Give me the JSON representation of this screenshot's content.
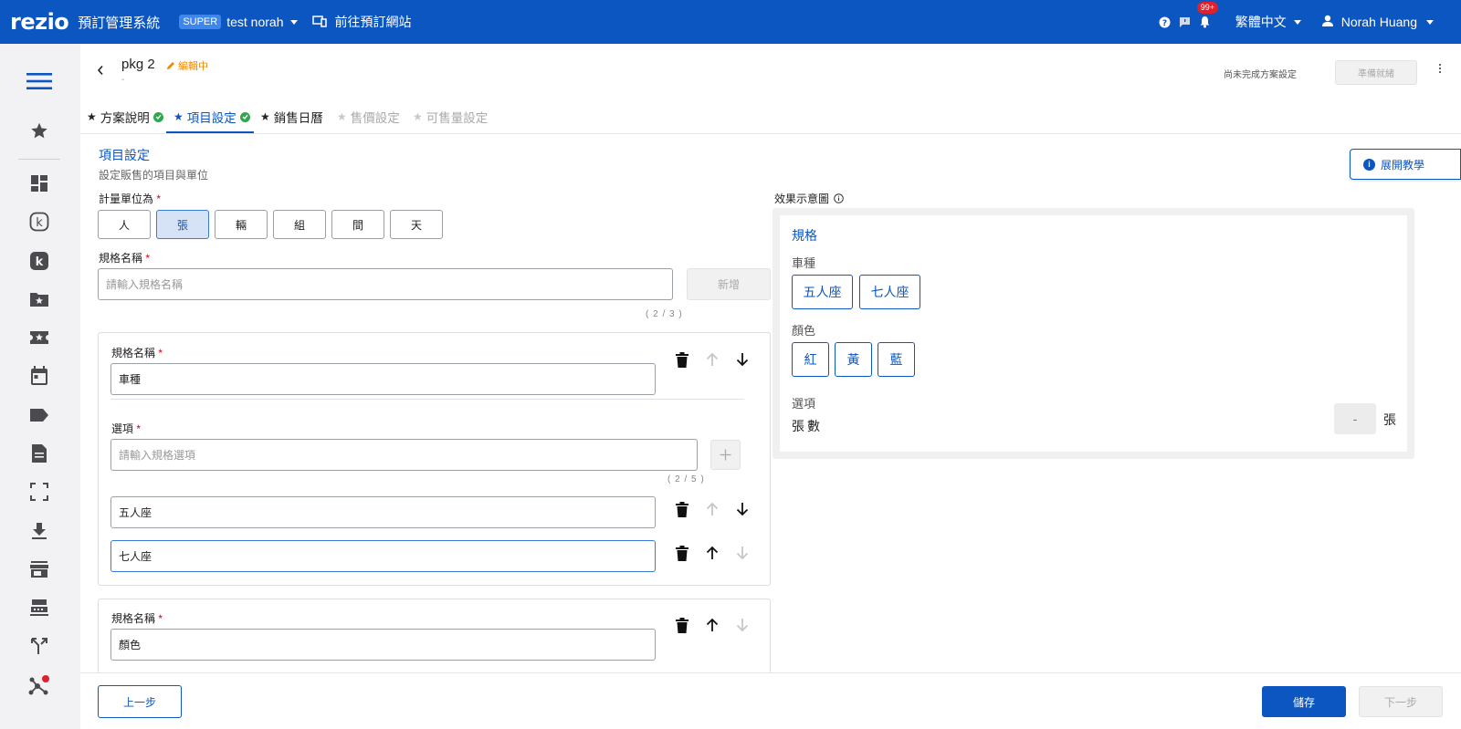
{
  "header": {
    "logo": "rezio",
    "system_title": "預訂管理系統",
    "badge": "SUPER",
    "account": "test norah",
    "goto_link": "前往預訂網站",
    "notif_count": "99+",
    "language": "繁體中文",
    "user": "Norah Huang"
  },
  "sidebar": {
    "icons": [
      "menu-icon",
      "star-icon",
      "dashboard-icon",
      "k-outline-icon",
      "k-filled-icon",
      "folder-star-icon",
      "ticket-star-icon",
      "calendar-icon",
      "tag-icon",
      "document-icon",
      "fullscreen-icon",
      "download-icon",
      "store-icon",
      "cash-register-icon",
      "merge-icon",
      "hub-icon"
    ]
  },
  "page": {
    "title": "pkg 2",
    "subtitle": "-",
    "status": "編輯中",
    "incomplete_text": "尚未完成方案設定",
    "ready_label": "準備就緒"
  },
  "tabs": [
    {
      "label": "方案說明"
    },
    {
      "label": "項目設定"
    },
    {
      "label": "銷售日曆"
    },
    {
      "label": "售價設定"
    },
    {
      "label": "可售量設定"
    }
  ],
  "section": {
    "title": "項目設定",
    "subtitle": "設定販售的項目與單位",
    "tutorial": "展開教學"
  },
  "unit": {
    "label": "計量單位為",
    "options": [
      "人",
      "張",
      "輛",
      "組",
      "間",
      "天"
    ],
    "selected": "張"
  },
  "spec_name": {
    "label": "規格名稱",
    "placeholder": "請輸入規格名稱",
    "add_label": "新增",
    "counter": "( 2 / 3 )"
  },
  "spec_cards": [
    {
      "name_label": "規格名稱",
      "name_value": "車種",
      "options_label": "選項",
      "option_placeholder": "請輸入規格選項",
      "counter": "( 2 / 5 )",
      "options": [
        "五人座",
        "七人座"
      ]
    },
    {
      "name_label": "規格名稱",
      "name_value": "顏色"
    }
  ],
  "required_mark": "*",
  "preview": {
    "label": "效果示意圖",
    "title": "規格",
    "groups": [
      {
        "label": "車種",
        "options": [
          "五人座",
          "七人座"
        ]
      },
      {
        "label": "顏色",
        "options": [
          "紅",
          "黃",
          "藍"
        ]
      }
    ],
    "qty_label": "選項",
    "qty_name": "張數",
    "qty_value": "-",
    "qty_unit": "張"
  },
  "footer": {
    "prev": "上一步",
    "save": "儲存",
    "next": "下一步"
  },
  "colors": {
    "primary": "#0b56c1",
    "accent_orange": "#f08a00",
    "success": "#2aa84a",
    "required": "#d0021b"
  }
}
